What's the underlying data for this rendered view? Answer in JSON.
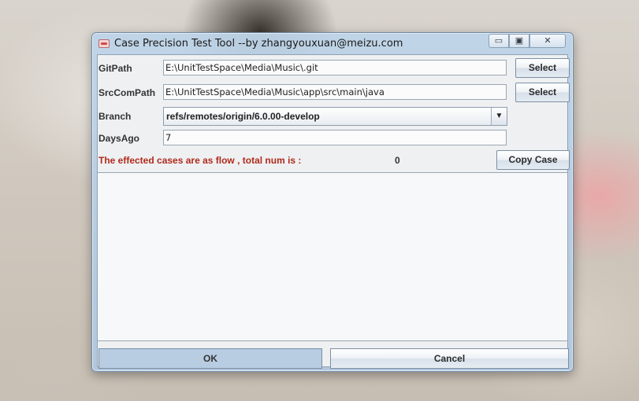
{
  "window": {
    "title": "Case Precision Test Tool --by zhangyouxuan@meizu.com",
    "controls": {
      "minimize": "▭",
      "maximize": "▣",
      "close": "✕"
    }
  },
  "form": {
    "gitpath": {
      "label": "GitPath",
      "value": "E:\\UnitTestSpace\\Media\\Music\\.git",
      "button": "Select"
    },
    "srccompath": {
      "label": "SrcComPath",
      "value": "E:\\UnitTestSpace\\Media\\Music\\app\\src\\main\\java",
      "button": "Select"
    },
    "branch": {
      "label": "Branch",
      "value": "refs/remotes/origin/6.0.00-develop",
      "arrow": "▼"
    },
    "daysago": {
      "label": "DaysAgo",
      "value": "7"
    }
  },
  "results": {
    "label": "The effected cases are as flow , total num is :",
    "total": "0",
    "copy_button": "Copy Case",
    "label_color": "#b02a1a"
  },
  "footer": {
    "ok": "OK",
    "cancel": "Cancel"
  },
  "icons": {
    "app": "app-icon"
  }
}
